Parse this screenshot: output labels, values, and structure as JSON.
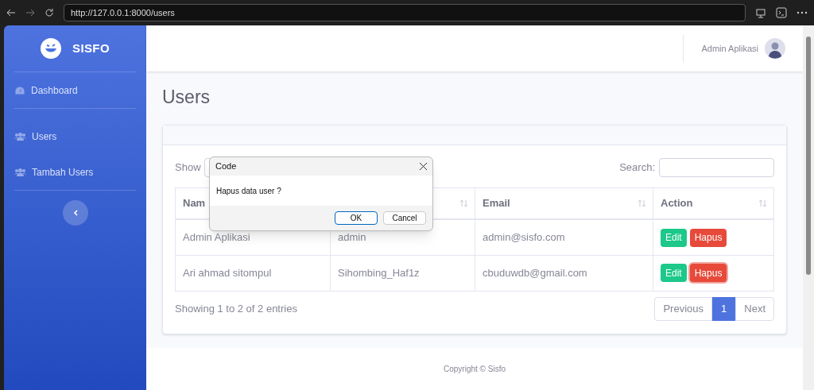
{
  "browser": {
    "url": "http://127.0.0.1:8000/users"
  },
  "sidebar": {
    "brand": "SISFO",
    "items": [
      {
        "label": "Dashboard",
        "kind": "dashboard",
        "selected": false
      },
      {
        "label": "Users",
        "kind": "users",
        "selected": false
      },
      {
        "label": "Tambah Users",
        "kind": "users",
        "selected": false
      }
    ]
  },
  "topbar": {
    "user_name": "Admin Aplikasi"
  },
  "page_title": "Users",
  "table_controls": {
    "show_label": "Show",
    "search_label": "Search:"
  },
  "table": {
    "columns": [
      {
        "label": "Nam"
      },
      {},
      {
        "label": "Email"
      },
      {
        "label": "Action"
      }
    ],
    "rows": [
      {
        "name": "Admin Aplikasi",
        "username": "admin",
        "email": "admin@sisfo.com",
        "actions": [
          {
            "label": "Edit",
            "kind": "edit",
            "focused": false
          },
          {
            "label": "Hapus",
            "kind": "delete",
            "focused": false
          }
        ]
      },
      {
        "name": "Ari ahmad sitompul",
        "username": "Sihombing_Haf1z",
        "email": "cbuduwdb@gmail.com",
        "actions": [
          {
            "label": "Edit",
            "kind": "edit",
            "focused": false
          },
          {
            "label": "Hapus",
            "kind": "delete",
            "focused": true
          }
        ]
      }
    ]
  },
  "info": "Showing 1 to 2 of 2 entries",
  "pagination": [
    {
      "label": "Previous",
      "selected": false
    },
    {
      "label": "1",
      "selected": true
    },
    {
      "label": "Next",
      "selected": false
    }
  ],
  "footer": "Copyright © Sisfo",
  "dialog": {
    "title": "Code",
    "message": "Hapus data user ?",
    "buttons": [
      {
        "label": "OK",
        "selected": true
      },
      {
        "label": "Cancel",
        "selected": false
      }
    ]
  }
}
